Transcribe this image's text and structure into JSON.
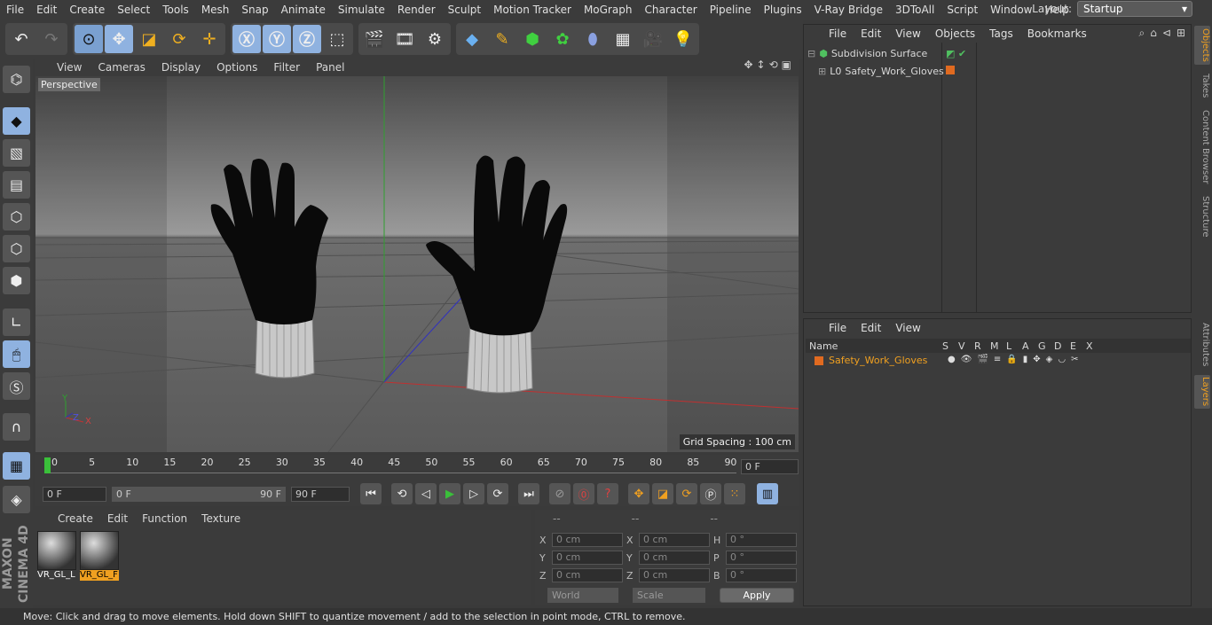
{
  "menu": {
    "items": [
      "File",
      "Edit",
      "Create",
      "Select",
      "Tools",
      "Mesh",
      "Snap",
      "Animate",
      "Simulate",
      "Render",
      "Sculpt",
      "Motion Tracker",
      "MoGraph",
      "Character",
      "Pipeline",
      "Plugins",
      "V-Ray Bridge",
      "3DToAll",
      "Script",
      "Window",
      "Help"
    ],
    "layout_label": "Layout:",
    "layout_value": "Startup"
  },
  "viewport": {
    "menu": [
      "View",
      "Cameras",
      "Display",
      "Options",
      "Filter",
      "Panel"
    ],
    "label": "Perspective",
    "grid_spacing": "Grid Spacing : 100 cm",
    "axis_x": "X",
    "axis_y": "Y",
    "axis_z": "Z"
  },
  "timeline": {
    "ticks": [
      "0",
      "5",
      "10",
      "15",
      "20",
      "25",
      "30",
      "35",
      "40",
      "45",
      "50",
      "55",
      "60",
      "65",
      "70",
      "75",
      "80",
      "85",
      "90"
    ],
    "current_frame": "0 F"
  },
  "transport": {
    "start": "0 F",
    "range_start": "0 F",
    "range_end": "90 F",
    "end": "90 F"
  },
  "material_manager": {
    "menu": [
      "Create",
      "Edit",
      "Function",
      "Texture"
    ],
    "materials": [
      {
        "name": "VR_GL_L",
        "selected": false
      },
      {
        "name": "VR_GL_F",
        "selected": true
      }
    ]
  },
  "coordinates": {
    "headers": [
      "--",
      "--",
      "--"
    ],
    "rows": [
      {
        "l1": "X",
        "v1": "0 cm",
        "l2": "X",
        "v2": "0 cm",
        "l3": "H",
        "v3": "0 °"
      },
      {
        "l1": "Y",
        "v1": "0 cm",
        "l2": "Y",
        "v2": "0 cm",
        "l3": "P",
        "v3": "0 °"
      },
      {
        "l1": "Z",
        "v1": "0 cm",
        "l2": "Z",
        "v2": "0 cm",
        "l3": "B",
        "v3": "0 °"
      }
    ],
    "mode": "World",
    "transform": "Scale",
    "apply_label": "Apply"
  },
  "object_manager": {
    "menu": [
      "File",
      "Edit",
      "View",
      "Objects",
      "Tags",
      "Bookmarks"
    ],
    "objects": [
      {
        "name": "Subdivision Surface"
      },
      {
        "name": "Safety_Work_Gloves"
      }
    ]
  },
  "layer_manager": {
    "menu": [
      "File",
      "Edit",
      "View"
    ],
    "columns": [
      "Name",
      "S",
      "V",
      "R",
      "M",
      "L",
      "A",
      "G",
      "D",
      "E",
      "X"
    ],
    "layers": [
      {
        "name": "Safety_Work_Gloves"
      }
    ]
  },
  "side_tabs": [
    "Objects",
    "Takes",
    "Content Browser",
    "Structure",
    "Attributes",
    "Layers"
  ],
  "brand": "MAXON CINEMA 4D",
  "status": "Move: Click and drag to move elements. Hold down SHIFT to quantize movement / add to the selection in point mode, CTRL to remove.",
  "colors": {
    "accent": "#f0a020",
    "highlight": "#8fb2e0",
    "layer_color": "#e06a20"
  }
}
